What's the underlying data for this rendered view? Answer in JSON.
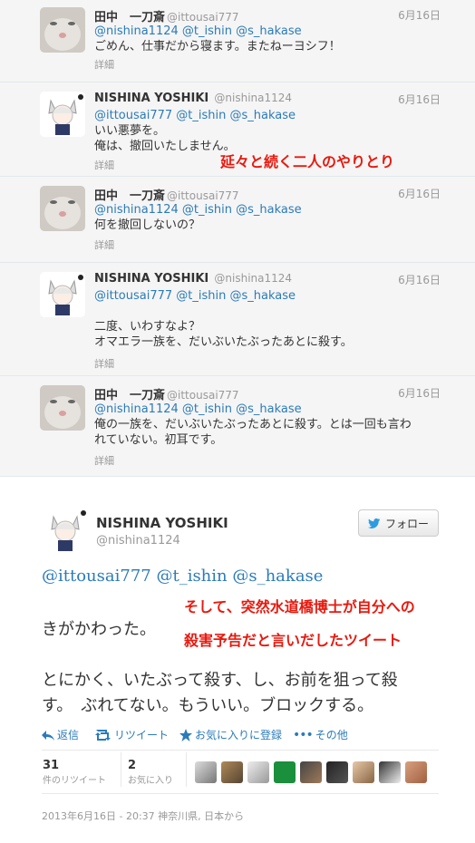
{
  "tweets": [
    {
      "name": "田中　一刀斎",
      "handle": "@ittousai777",
      "date": "6月16日",
      "mentions": "@nishina1124 @t_ishin @s_hakase",
      "lines": [
        "ごめん、仕事だから寝ます。またねーヨシフ！"
      ],
      "detail": "詳細",
      "avatar": "cat"
    },
    {
      "name": "NISHINA YOSHIKI",
      "handle": "@nishina1124",
      "date": "6月16日",
      "mentions": "@ittousai777 @t_ishin @s_hakase",
      "lines": [
        "いい悪夢を。",
        "俺は、撤回いたしません。"
      ],
      "detail": "詳細",
      "avatar": "anime"
    },
    {
      "name": "田中　一刀斎",
      "handle": "@ittousai777",
      "date": "6月16日",
      "mentions": "@nishina1124 @t_ishin @s_hakase",
      "lines": [
        "何を撤回しないの？"
      ],
      "detail": "詳細",
      "avatar": "cat"
    },
    {
      "name": "NISHINA YOSHIKI",
      "handle": "@nishina1124",
      "date": "6月16日",
      "mentions": "@ittousai777 @t_ishin @s_hakase",
      "lines": [
        "",
        "二度、いわすなよ？",
        "オマエラ一族を、だいぶいたぶったあとに殺す。"
      ],
      "detail": "詳細",
      "avatar": "anime"
    },
    {
      "name": "田中　一刀斎",
      "handle": "@ittousai777",
      "date": "6月16日",
      "mentions": "@nishina1124 @t_ishin @s_hakase",
      "lines": [
        "俺の一族を、だいぶいたぶったあとに殺す。とは一回も言わ",
        "れていない。初耳です。"
      ],
      "detail": "詳細",
      "avatar": "cat"
    }
  ],
  "annotations": {
    "a1": "延々と続く二人のやりとり",
    "a2_line1": "そして、突然水道橋博士が自分への",
    "a2_line2": "殺害予告だと言いだしたツイート"
  },
  "main": {
    "name": "NISHINA YOSHIKI",
    "handle": "@nishina1124",
    "follow_label": "フォロー",
    "mentions": "@ittousai777 @t_ishin @s_hakase",
    "line1": "きがかわった。",
    "line2": "とにかく、いたぶって殺す、し、お前を狙って殺",
    "line3": "す。　ぶれてない。もういい。ブロックする。",
    "actions": {
      "reply": "返信",
      "retweet": "リツイート",
      "favorite": "お気に入りに登録",
      "more": "その他"
    },
    "stats": {
      "retweets": "31",
      "retweets_label": "件のリツイート",
      "favorites": "2",
      "favorites_label": "お気に入り"
    },
    "timestamp": "2013年6月16日 - 20:37 神奈川県, 日本から"
  },
  "colors": {
    "link": "#2b7bb9",
    "annotation": "#e8190e",
    "thread_bg": "#f5f5f5"
  }
}
